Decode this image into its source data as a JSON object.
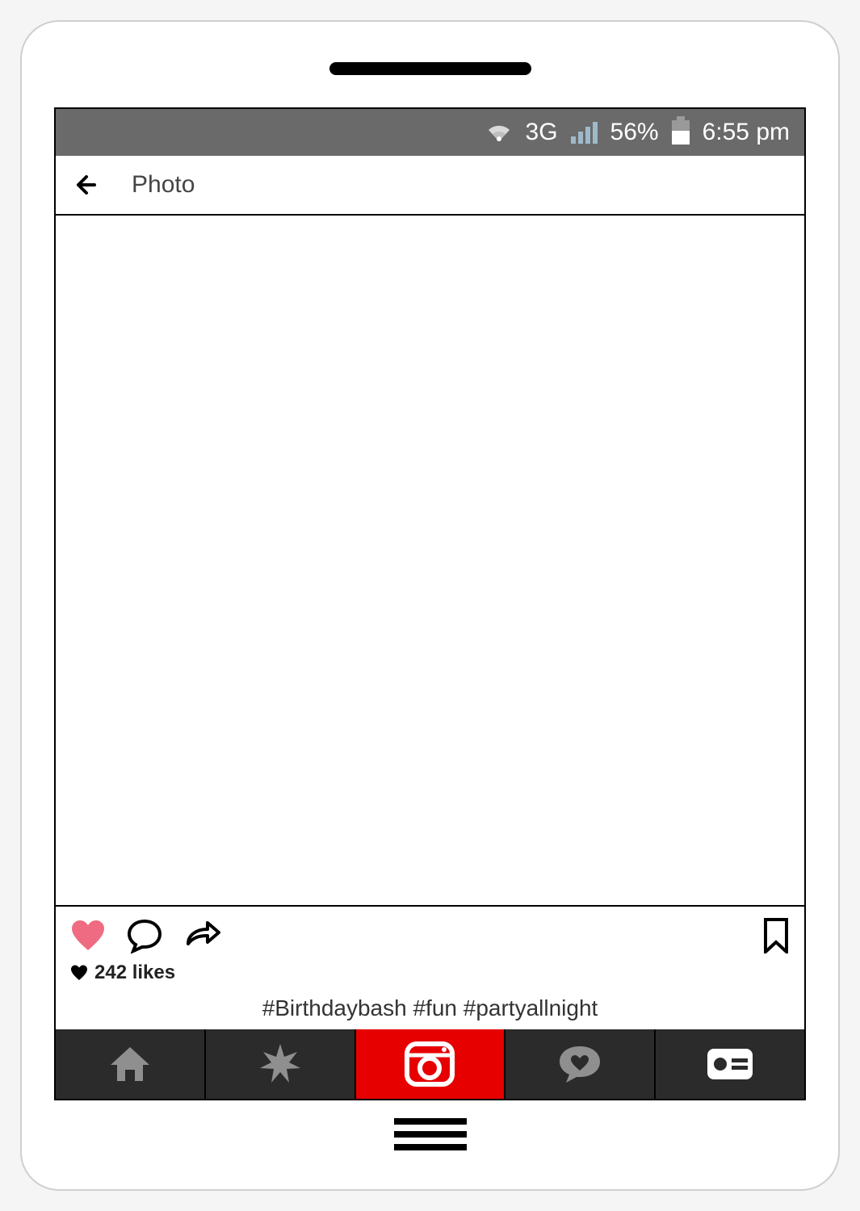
{
  "status_bar": {
    "network_label": "3G",
    "battery_pct": "56%",
    "time": "6:55 pm"
  },
  "header": {
    "title": "Photo"
  },
  "post": {
    "likes_text": "242 likes",
    "caption": "#Birthdaybash #fun #partyallnight"
  },
  "colors": {
    "accent_red": "#e60000",
    "heart_pink": "#ef6b81",
    "status_bg": "#6a6a6a"
  }
}
